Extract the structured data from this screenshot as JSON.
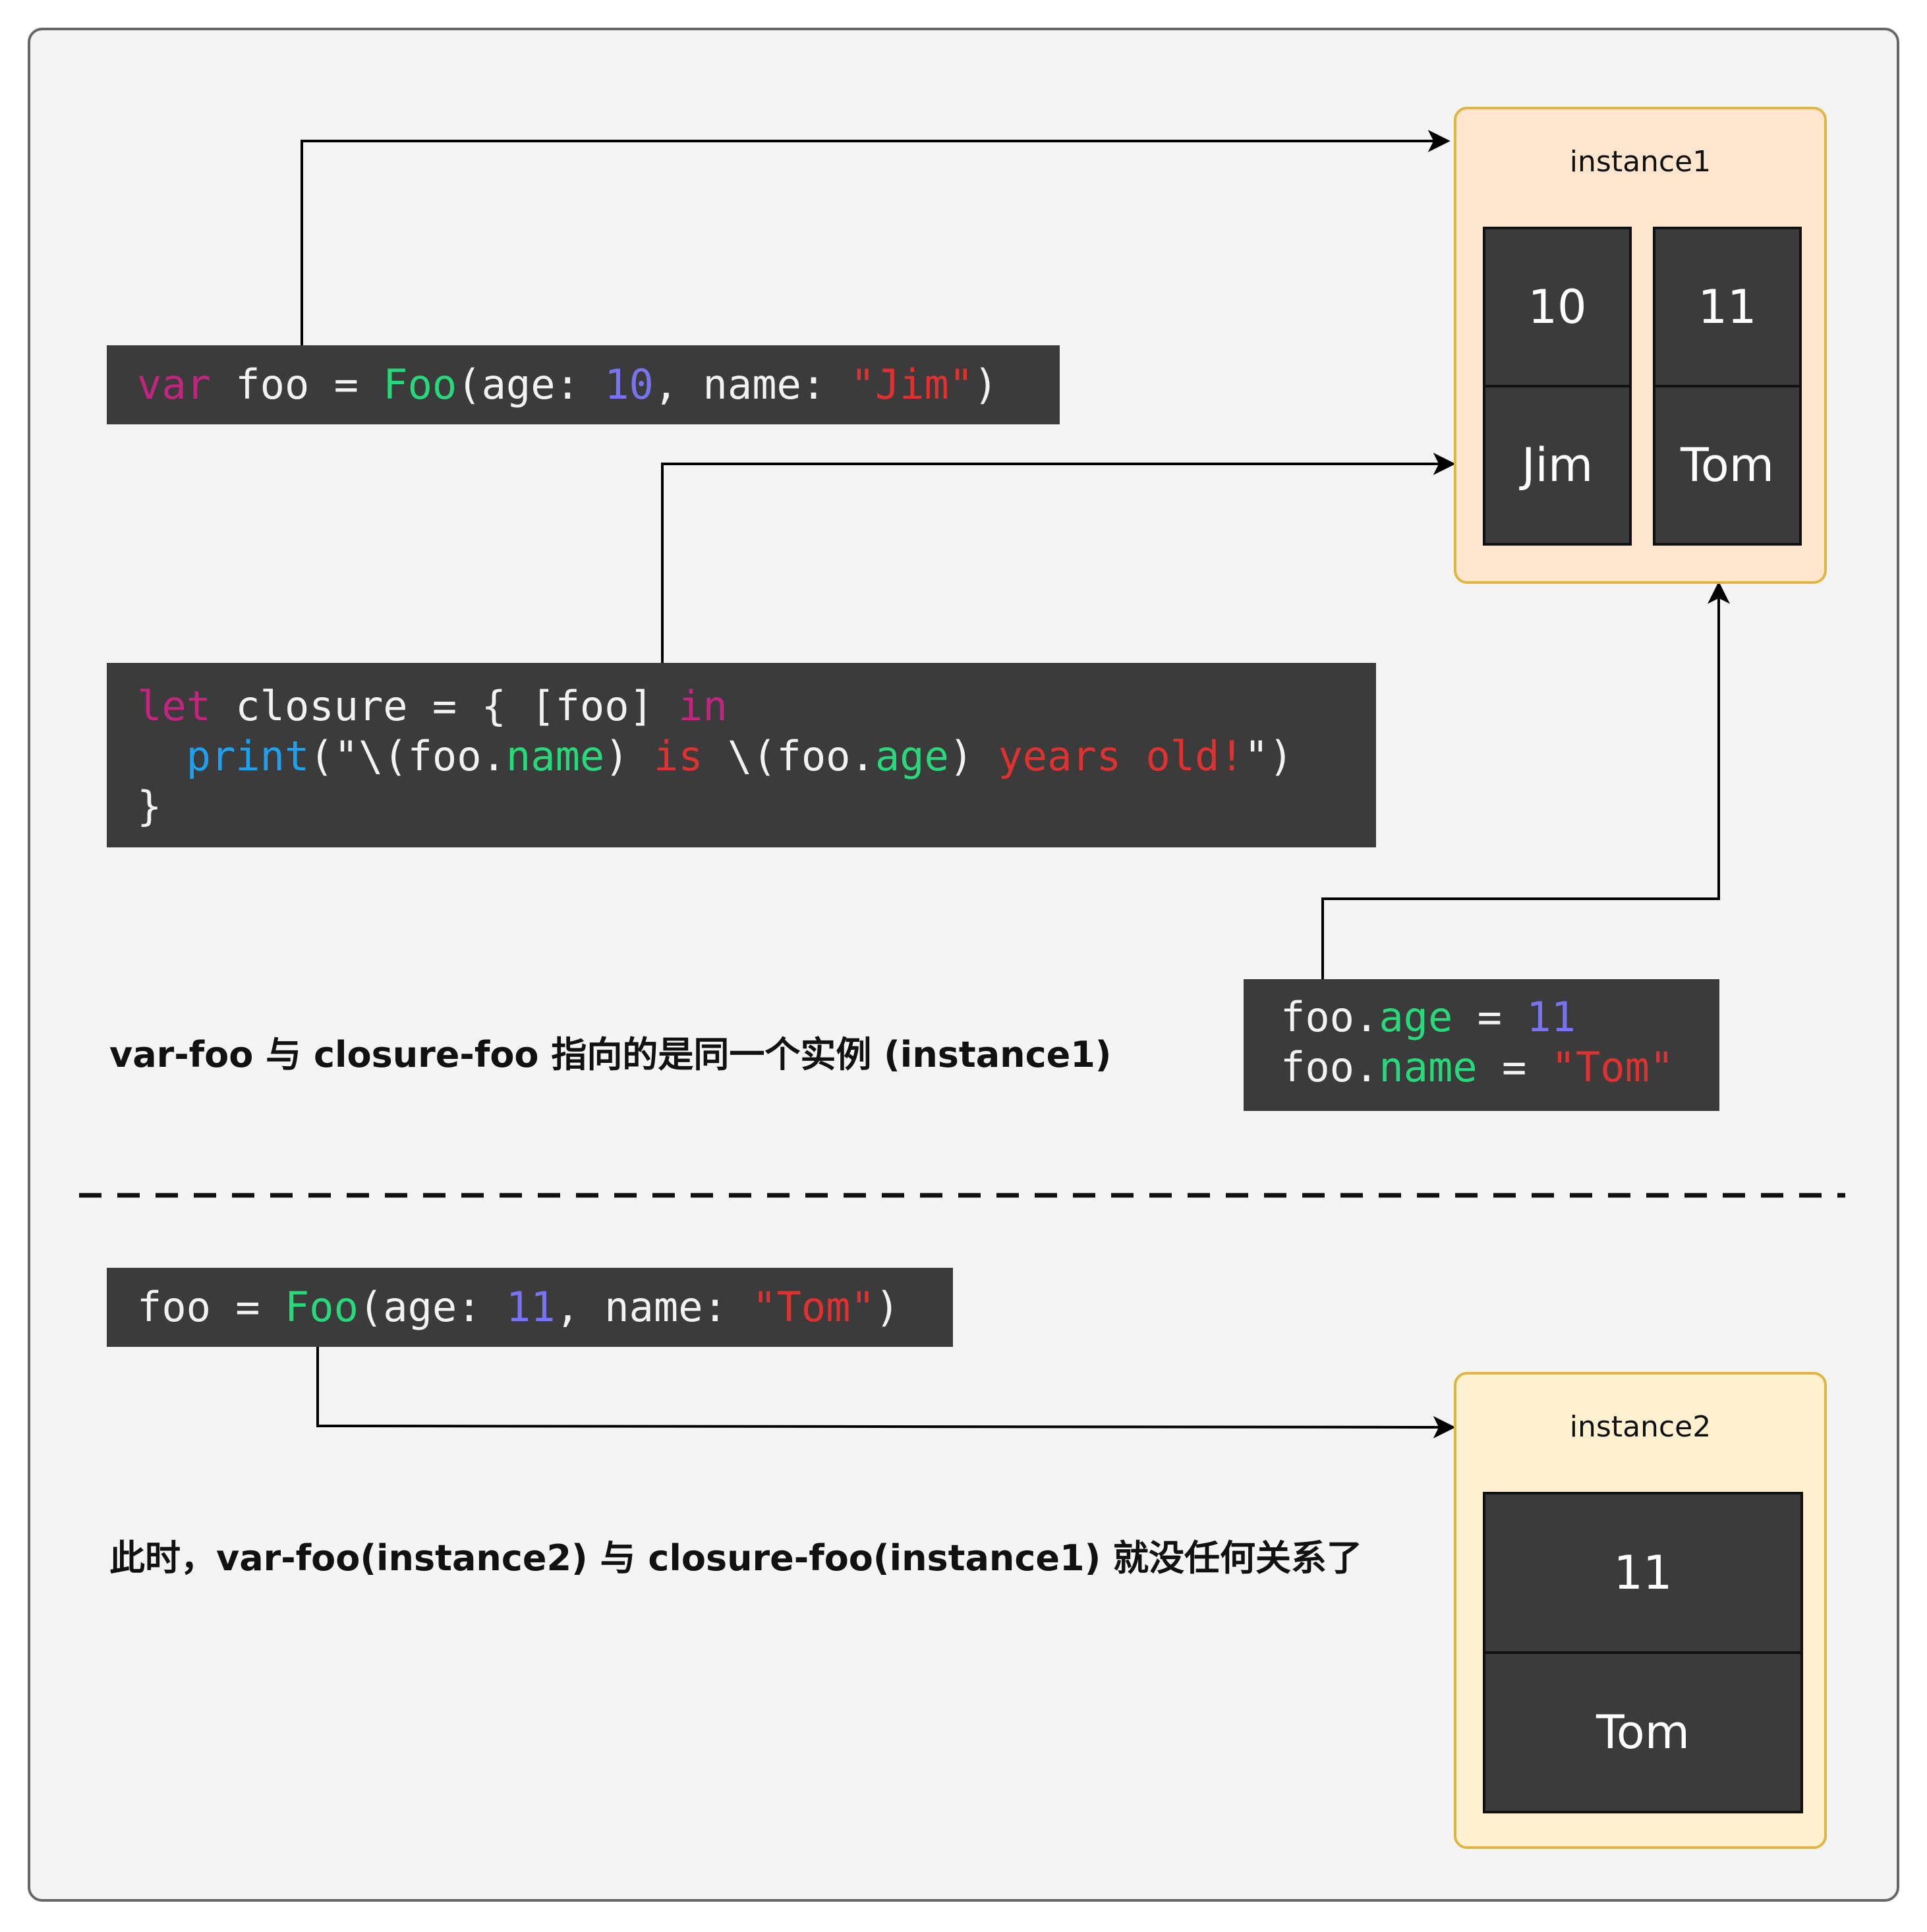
{
  "code_blocks": {
    "var_foo": [
      {
        "t": "var",
        "c": "kw"
      },
      {
        "t": " foo = "
      },
      {
        "t": "Foo",
        "c": "fn"
      },
      {
        "t": "(age: "
      },
      {
        "t": "10",
        "c": "num"
      },
      {
        "t": ", name: "
      },
      {
        "t": "\"Jim\"",
        "c": "str"
      },
      {
        "t": ")"
      }
    ],
    "closure": [
      [
        {
          "t": "let",
          "c": "kw"
        },
        {
          "t": " closure = { [foo] "
        },
        {
          "t": "in",
          "c": "kw"
        }
      ],
      [
        {
          "t": "  "
        },
        {
          "t": "print",
          "c": "call"
        },
        {
          "t": "(\"\\(foo."
        },
        {
          "t": "name",
          "c": "prop"
        },
        {
          "t": ") "
        },
        {
          "t": "is",
          "c": "str"
        },
        {
          "t": " \\(foo."
        },
        {
          "t": "age",
          "c": "prop"
        },
        {
          "t": ") "
        },
        {
          "t": "years old!",
          "c": "str"
        },
        {
          "t": "\")"
        }
      ],
      [
        {
          "t": "}"
        }
      ]
    ],
    "mutate": [
      [
        {
          "t": "foo."
        },
        {
          "t": "age",
          "c": "prop"
        },
        {
          "t": " = "
        },
        {
          "t": "11",
          "c": "num"
        }
      ],
      [
        {
          "t": "foo."
        },
        {
          "t": "name",
          "c": "prop"
        },
        {
          "t": " = "
        },
        {
          "t": "\"Tom\"",
          "c": "str"
        }
      ]
    ],
    "reassign": [
      {
        "t": "foo = "
      },
      {
        "t": "Foo",
        "c": "fn"
      },
      {
        "t": "(age: "
      },
      {
        "t": "11",
        "c": "num"
      },
      {
        "t": ", name: "
      },
      {
        "t": "\"Tom\"",
        "c": "str"
      },
      {
        "t": ")"
      }
    ]
  },
  "instance1": {
    "title": "instance1",
    "old_age": "10",
    "old_name": "Jim",
    "new_age": "11",
    "new_name": "Tom"
  },
  "instance2": {
    "title": "instance2",
    "age": "11",
    "name": "Tom"
  },
  "notes": {
    "same_instance": "var-foo 与 closure-foo 指向的是同一个实例 (instance1)",
    "no_relation": "此时，var-foo(instance2) 与 closure-foo(instance1) 就没任何关系了"
  },
  "colors": {
    "instance1_fill": "#fde6cd",
    "instance2_fill": "#fdf1cf",
    "code_bg": "#3b3b3b",
    "keyword": "#c2257f",
    "type": "#27d97a",
    "number": "#7a73ee",
    "string": "#e03131",
    "function": "#1ea0f0"
  }
}
